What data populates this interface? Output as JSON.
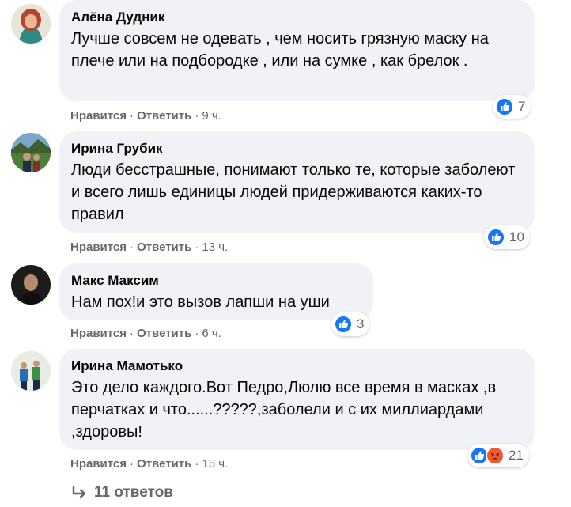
{
  "action_labels": {
    "like": "Нравится",
    "reply": "Ответить",
    "separator": "·"
  },
  "comments": [
    {
      "author": "Алёна Дудник",
      "text": "Лучше совсем не одевать , чем носить грязную маску на плече или на подбородке , или на сумке , как брелок .",
      "time": "9 ч.",
      "reactions": [
        "like-icon"
      ],
      "reaction_count": "7"
    },
    {
      "author": "Ирина Грубик",
      "text": "Люди бесстрашные, понимают только те, которые заболеют и всего лишь единицы людей придерживаются каких-то правил",
      "time": "13 ч.",
      "reactions": [
        "like-icon"
      ],
      "reaction_count": "10"
    },
    {
      "author": "Макс Максим",
      "text": "Нам пох!и это вызов лапши на уши",
      "time": "6 ч.",
      "reactions": [
        "like-icon"
      ],
      "reaction_count": "3"
    },
    {
      "author": "Ирина Мамотько",
      "text": "Это дело каждого.Вот Педро,Люлю все время в масках ,в перчатках и что......?????,заболели и с их миллиардами ,здоровы!",
      "time": "15 ч.",
      "reactions": [
        "like-icon",
        "angry-icon"
      ],
      "reaction_count": "21"
    }
  ],
  "replies_link": {
    "label": "11 ответов",
    "icon": "reply-arrow-icon"
  },
  "colors": {
    "like_blue": "#1877f2",
    "angry_orange": "#f0592b",
    "bubble_bg": "#f0f2f5",
    "meta_gray": "#65676b"
  }
}
